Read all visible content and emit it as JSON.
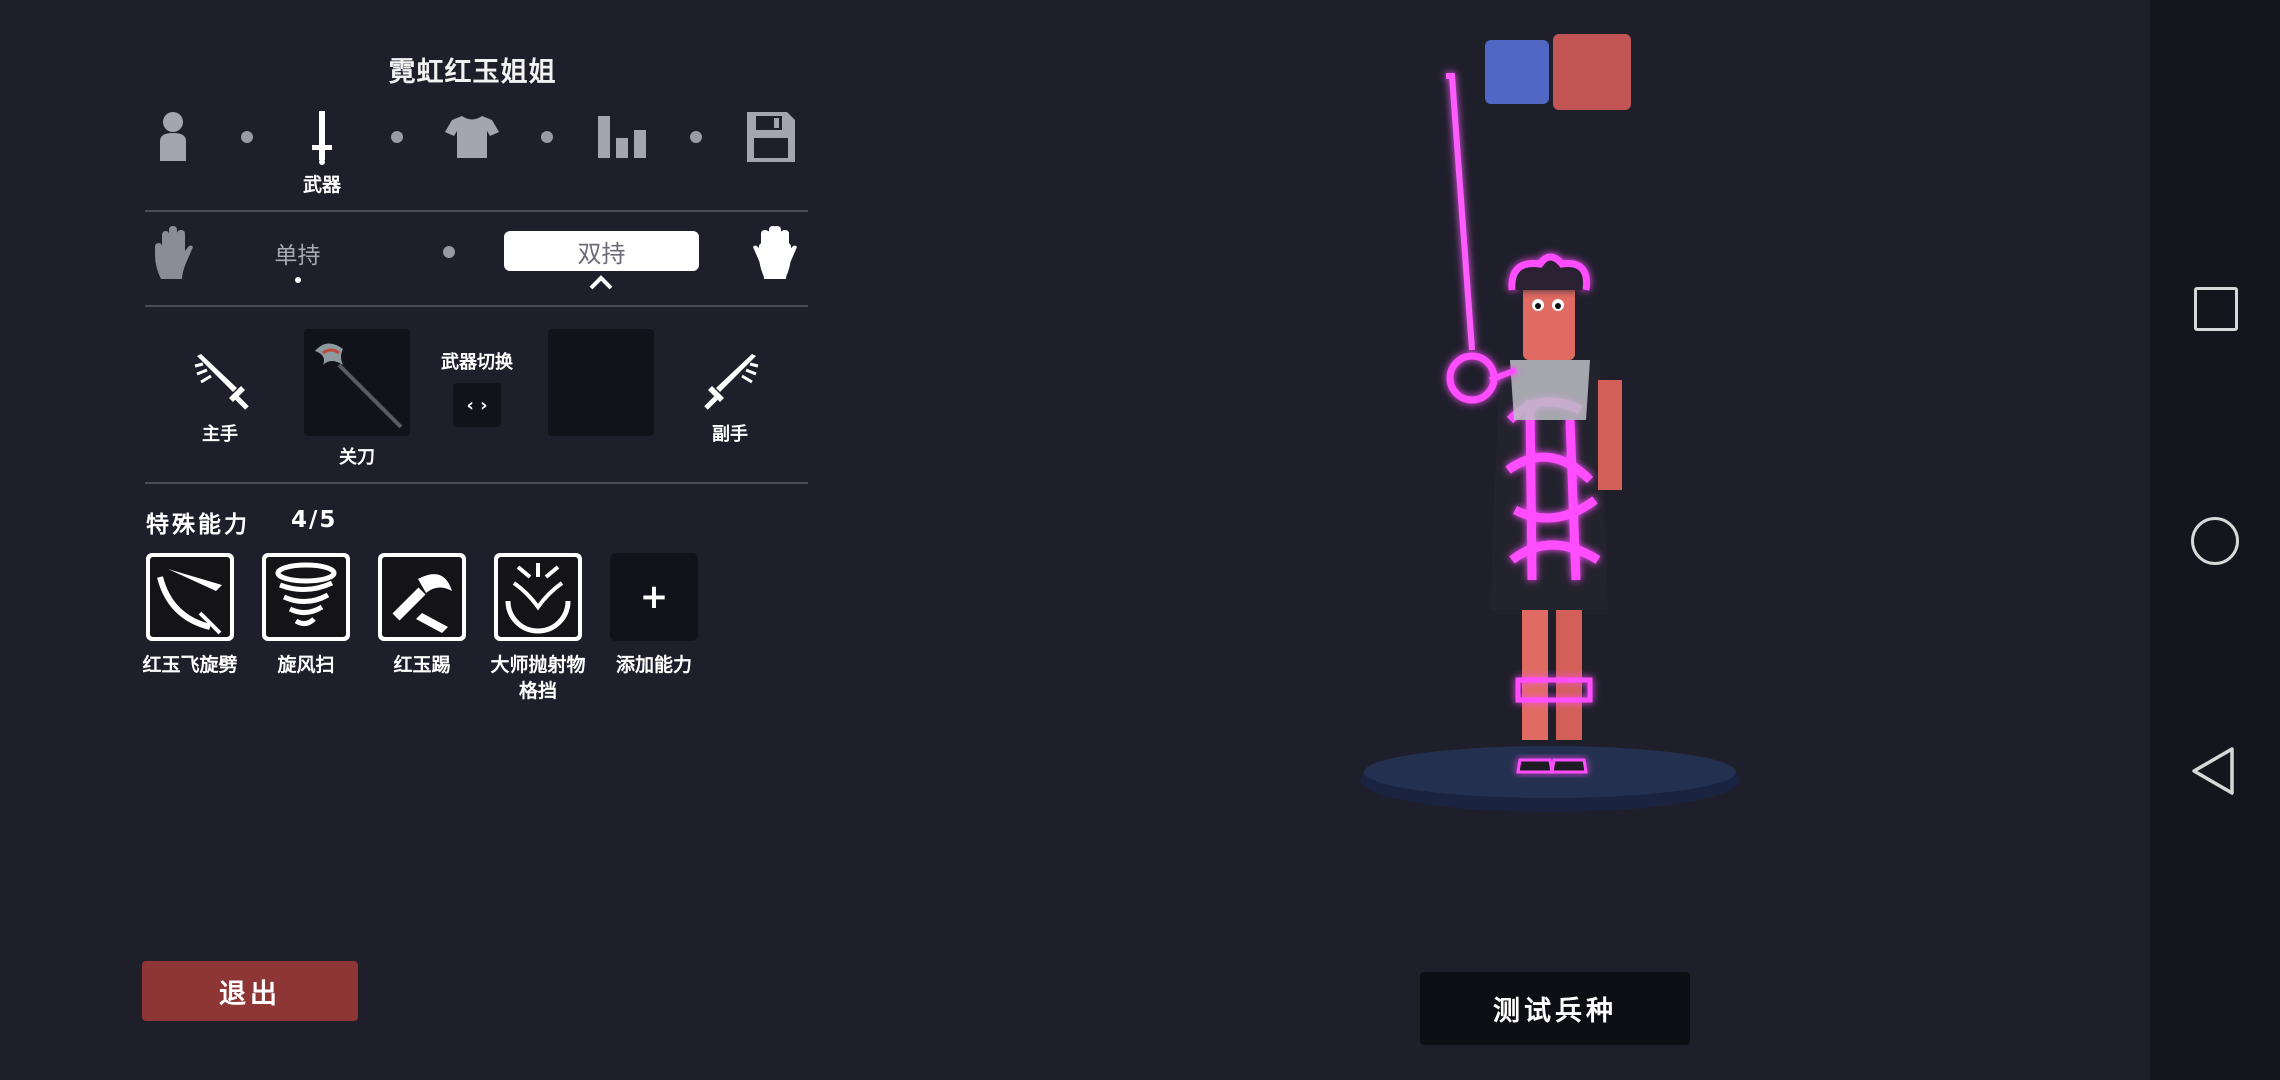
{
  "unit_title": "霓虹红玉姐姐",
  "steps": {
    "active_label": "武器",
    "icons": [
      "person-icon",
      "sword-icon",
      "shirt-icon",
      "bars-icon",
      "save-icon"
    ]
  },
  "grip": {
    "single_label": "单持",
    "dual_label": "双持",
    "selected": "双持"
  },
  "weapons": {
    "main_hand_label": "主手",
    "main_weapon_name": "关刀",
    "switch_label": "武器切换",
    "switch_symbol": "‹ ›",
    "off_hand_label": "副手"
  },
  "abilities": {
    "heading": "特殊能力",
    "count": "4/5",
    "items": [
      {
        "label": "红玉飞旋劈",
        "icon": "spinning-slash-icon"
      },
      {
        "label": "旋风扫",
        "icon": "whirlwind-icon"
      },
      {
        "label": "红玉踢",
        "icon": "kick-icon"
      },
      {
        "label": "大师抛射物\n格挡",
        "icon": "projectile-block-icon"
      }
    ],
    "add_label": "添加能力",
    "add_symbol": "+"
  },
  "team_colors": {
    "blue": "#5167c4",
    "red": "#c45555"
  },
  "buttons": {
    "exit": "退出",
    "test": "测试兵种"
  },
  "colors": {
    "background": "#1f1f2b",
    "exit": "#8e3536",
    "neon": "#ff40ff"
  }
}
